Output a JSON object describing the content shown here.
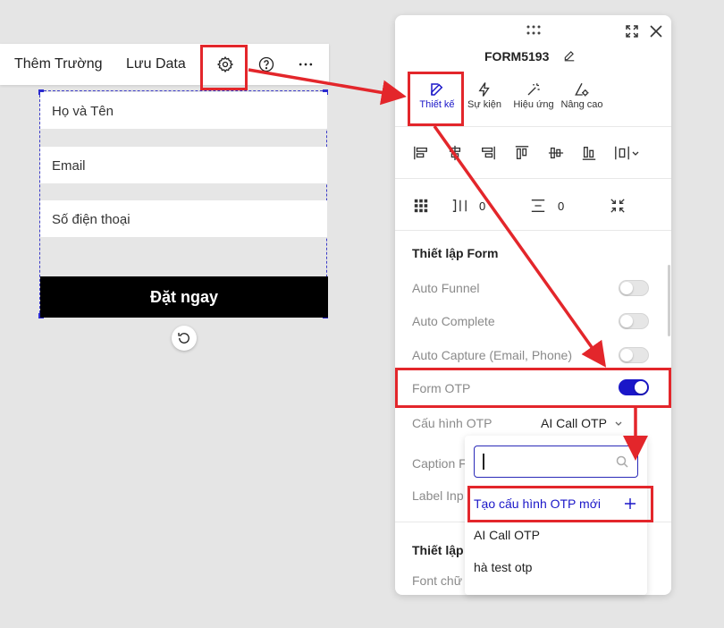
{
  "toolbar": {
    "add_field_label": "Thêm Trường",
    "save_data_label": "Lưu Data",
    "icons": [
      "gear-icon",
      "help-circle-icon",
      "more-horizontal-icon"
    ]
  },
  "form_preview": {
    "fields": [
      "Họ và Tên",
      "Email",
      "Số điện thoại"
    ],
    "submit_label": "Đặt ngay"
  },
  "panel": {
    "title": "FORM5193",
    "tabs": [
      {
        "label": "Thiết kế",
        "icon": "edit-icon",
        "active": true
      },
      {
        "label": "Sự kiện",
        "icon": "lightning-icon",
        "active": false
      },
      {
        "label": "Hiệu ứng",
        "icon": "magic-wand-icon",
        "active": false
      },
      {
        "label": "Nâng cao",
        "icon": "advanced-settings-icon",
        "active": false
      }
    ],
    "spacing_values": {
      "horizontal": "0",
      "vertical": "0"
    },
    "form_settings": {
      "title": "Thiết lập Form",
      "auto_funnel": {
        "label": "Auto Funnel",
        "on": false
      },
      "auto_complete": {
        "label": "Auto Complete",
        "on": false
      },
      "auto_capture": {
        "label": "Auto Capture (Email, Phone)",
        "on": false
      },
      "form_otp": {
        "label": "Form OTP",
        "on": true
      },
      "otp_config": {
        "label": "Cấu hình OTP",
        "value": "AI Call OTP"
      },
      "caption_partial": "Caption F",
      "label_input_partial": "Label Inp"
    },
    "section2_partial": "Thiết lập",
    "font_partial": "Font chữ"
  },
  "otp_dropdown": {
    "search_value": "",
    "create_label": "Tạo cấu hình OTP mới",
    "options": [
      "AI Call OTP",
      "hà test otp"
    ]
  },
  "colors": {
    "accent": "#1a16c8",
    "annotation_red": "#e3262b",
    "submit_bg": "#000000"
  }
}
